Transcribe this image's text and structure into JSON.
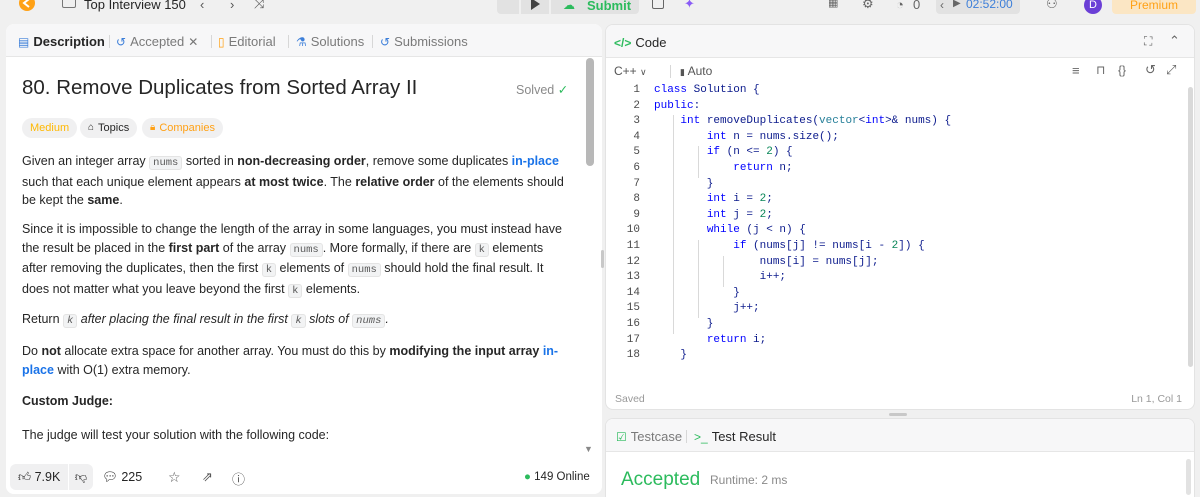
{
  "topbar": {
    "title": "Top Interview 150",
    "submit_label": "Submit",
    "timer": "02:52:00",
    "streak_count": "0",
    "avatar_letter": "D",
    "premium_label": "Premium"
  },
  "left_tabs": {
    "description": "Description",
    "accepted": "Accepted",
    "editorial": "Editorial",
    "solutions": "Solutions",
    "submissions": "Submissions"
  },
  "problem": {
    "title": "80. Remove Duplicates from Sorted Array II",
    "solved_label": "Solved",
    "difficulty": "Medium",
    "topics_label": "Topics",
    "companies_label": "Companies",
    "para1": {
      "t1": "Given an integer array ",
      "c1": "nums",
      "t2": " sorted in ",
      "b1": "non-decreasing order",
      "t3": ", remove some duplicates ",
      "blue1": "in-place",
      "t4": " such that each unique element appears ",
      "b2": "at most twice",
      "t5": ". The ",
      "b3": "relative order",
      "t6": " of the elements should be kept the ",
      "b4": "same",
      "t7": "."
    },
    "para2": {
      "t1": "Since it is impossible to change the length of the array in some languages, you must instead have the result be placed in the ",
      "b1": "first part",
      "t2": " of the array ",
      "c1": "nums",
      "t3": ". More formally, if there are ",
      "c2": "k",
      "t4": " elements after removing the duplicates, then the first ",
      "c3": "k",
      "t5": " elements of ",
      "c4": "nums",
      "t6": " should hold the final result. It does not matter what you leave beyond the first ",
      "c5": "k",
      "t7": " elements."
    },
    "para3": {
      "t1": "Return ",
      "c1": "k",
      "t2": " after placing the final result in the first ",
      "c2": "k",
      "t3": " slots of ",
      "c3": "nums",
      "t4": "."
    },
    "para4": {
      "t1": "Do ",
      "b1": "not",
      "t2": " allocate extra space for another array. You must do this by ",
      "b2": "modifying the input array",
      "t3": " ",
      "blue1": "in-place",
      "t4": " with O(1) extra memory."
    },
    "custom_judge_heading": "Custom Judge:",
    "judge_text": "The judge will test your solution with the following code:"
  },
  "footer": {
    "likes": "7.9K",
    "comments": "225",
    "online": "149 Online"
  },
  "editor": {
    "tab_label": "Code",
    "language": "C++",
    "mode": "Auto",
    "status": "Saved",
    "cursor": "Ln 1, Col 1",
    "lines": [
      "class Solution {",
      "public:",
      "    int removeDuplicates(vector<int>& nums) {",
      "        int n = nums.size();",
      "        if (n <= 2) {",
      "            return n;",
      "        }",
      "        int i = 2;",
      "        int j = 2;",
      "        while (j < n) {",
      "            if (nums[j] != nums[i - 2]) {",
      "                nums[i] = nums[j];",
      "                i++;",
      "            }",
      "            j++;",
      "        }",
      "        return i;",
      "    }"
    ],
    "line_numbers": [
      "1",
      "2",
      "3",
      "4",
      "5",
      "6",
      "7",
      "8",
      "9",
      "10",
      "11",
      "12",
      "13",
      "14",
      "15",
      "16",
      "17",
      "18"
    ]
  },
  "result": {
    "testcase_tab": "Testcase",
    "result_tab": "Test Result",
    "status": "Accepted",
    "runtime": "Runtime: 2 ms"
  },
  "colors": {
    "accent_green": "#2cbb5d",
    "medium": "#ffb800",
    "link_blue": "#1a73e8",
    "premium": "#ffa116",
    "avatar": "#6b3fd6"
  }
}
